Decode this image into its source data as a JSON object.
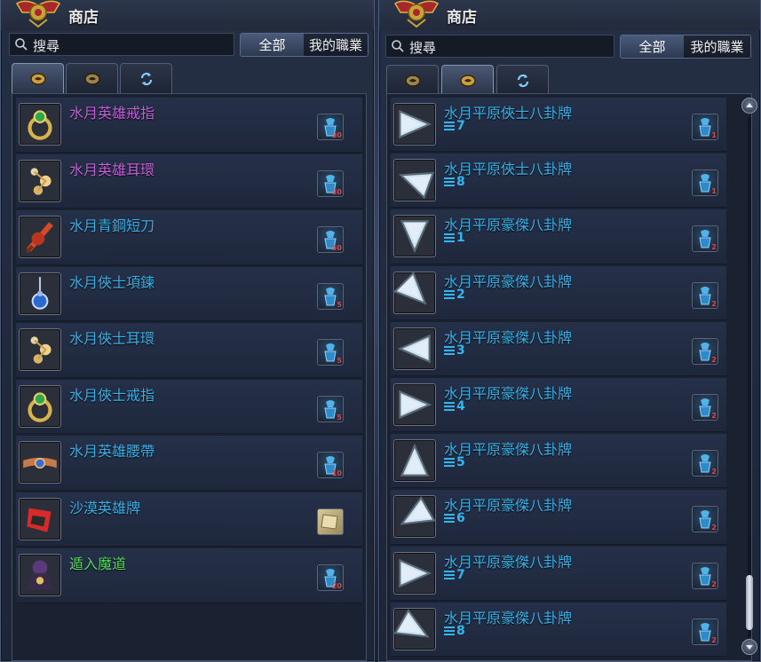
{
  "left": {
    "title": "商店",
    "search_text": "搜尋",
    "filter_all": "全部",
    "filter_job": "我的職業",
    "items": [
      {
        "name": "水月英雄戒指",
        "color": "#c45fd8",
        "cost": "30",
        "icon": "ring-icon"
      },
      {
        "name": "水月英雄耳環",
        "color": "#c45fd8",
        "cost": "30",
        "icon": "earring-icon"
      },
      {
        "name": "水月青鋼短刀",
        "color": "#39b0e8",
        "cost": "50",
        "icon": "dagger-icon"
      },
      {
        "name": "水月俠士項鍊",
        "color": "#39b0e8",
        "cost": "5",
        "icon": "necklace-icon"
      },
      {
        "name": "水月俠士耳環",
        "color": "#39b0e8",
        "cost": "5",
        "icon": "earring-icon"
      },
      {
        "name": "水月俠士戒指",
        "color": "#39b0e8",
        "cost": "5",
        "icon": "ring-icon"
      },
      {
        "name": "水月英雄腰帶",
        "color": "#39b0e8",
        "cost": "10",
        "icon": "belt-icon"
      },
      {
        "name": "沙漠英雄牌",
        "color": "#39b0e8",
        "cost": "",
        "icon": "badge-icon"
      },
      {
        "name": "遁入魔道",
        "color": "#55d860",
        "cost": "20",
        "icon": "costume-icon"
      }
    ]
  },
  "right": {
    "title": "商店",
    "search_text": "搜尋",
    "filter_all": "全部",
    "filter_job": "我的職業",
    "items": [
      {
        "name": "水月平原俠士八卦牌",
        "grade": "7",
        "cost": "1"
      },
      {
        "name": "水月平原俠士八卦牌",
        "grade": "8",
        "cost": "1"
      },
      {
        "name": "水月平原豪傑八卦牌",
        "grade": "1",
        "cost": "2"
      },
      {
        "name": "水月平原豪傑八卦牌",
        "grade": "2",
        "cost": "2"
      },
      {
        "name": "水月平原豪傑八卦牌",
        "grade": "3",
        "cost": "2"
      },
      {
        "name": "水月平原豪傑八卦牌",
        "grade": "4",
        "cost": "2"
      },
      {
        "name": "水月平原豪傑八卦牌",
        "grade": "5",
        "cost": "2"
      },
      {
        "name": "水月平原豪傑八卦牌",
        "grade": "6",
        "cost": "2"
      },
      {
        "name": "水月平原豪傑八卦牌",
        "grade": "7",
        "cost": "2"
      },
      {
        "name": "水月平原豪傑八卦牌",
        "grade": "8",
        "cost": "2"
      }
    ]
  },
  "colors": {
    "accent_blue": "#39b0e8",
    "cost_red": "#e04545"
  }
}
